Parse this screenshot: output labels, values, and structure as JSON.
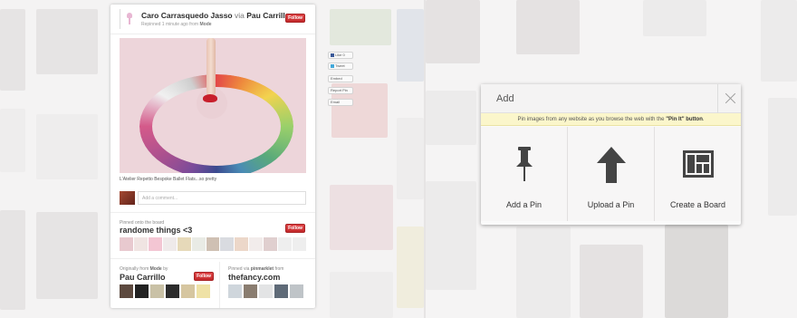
{
  "pin": {
    "pinner_name": "Caro Carrasquedo Jasso",
    "via_word": "via",
    "via_name": "Pau Carrillo",
    "repin_prefix": "Repinned 1 minute ago from",
    "repin_source": "Mode",
    "follow_label": "Follow",
    "description": "L'Atelier Repetto Bespoke Ballet Flats...so pretty",
    "comment_placeholder": "Add a comment..."
  },
  "board": {
    "label": "Pinned onto the board",
    "name": "randome things <3",
    "follow_label": "Follow"
  },
  "origin": {
    "left_label_prefix": "Originally from",
    "left_label_source": "Mode",
    "left_label_suffix": "by",
    "left_name": "Pau Carrillo",
    "left_follow": "Follow",
    "right_label_prefix": "Pinned via",
    "right_label_source": "pinmarklet",
    "right_label_suffix": "from",
    "right_name": "thefancy.com"
  },
  "social": {
    "like": "Like",
    "like_count": "0",
    "tweet": "Tweet",
    "embed": "Embed",
    "report": "Report Pin",
    "email": "Email"
  },
  "modal": {
    "title": "Add",
    "note_prefix": "Pin images from any website as you browse the web with the",
    "note_bold": "\"Pin It\" button",
    "note_suffix": ".",
    "options": [
      {
        "label": "Add a Pin",
        "icon": "pushpin-icon"
      },
      {
        "label": "Upload a Pin",
        "icon": "upload-arrow-icon"
      },
      {
        "label": "Create a Board",
        "icon": "board-grid-icon"
      }
    ]
  }
}
